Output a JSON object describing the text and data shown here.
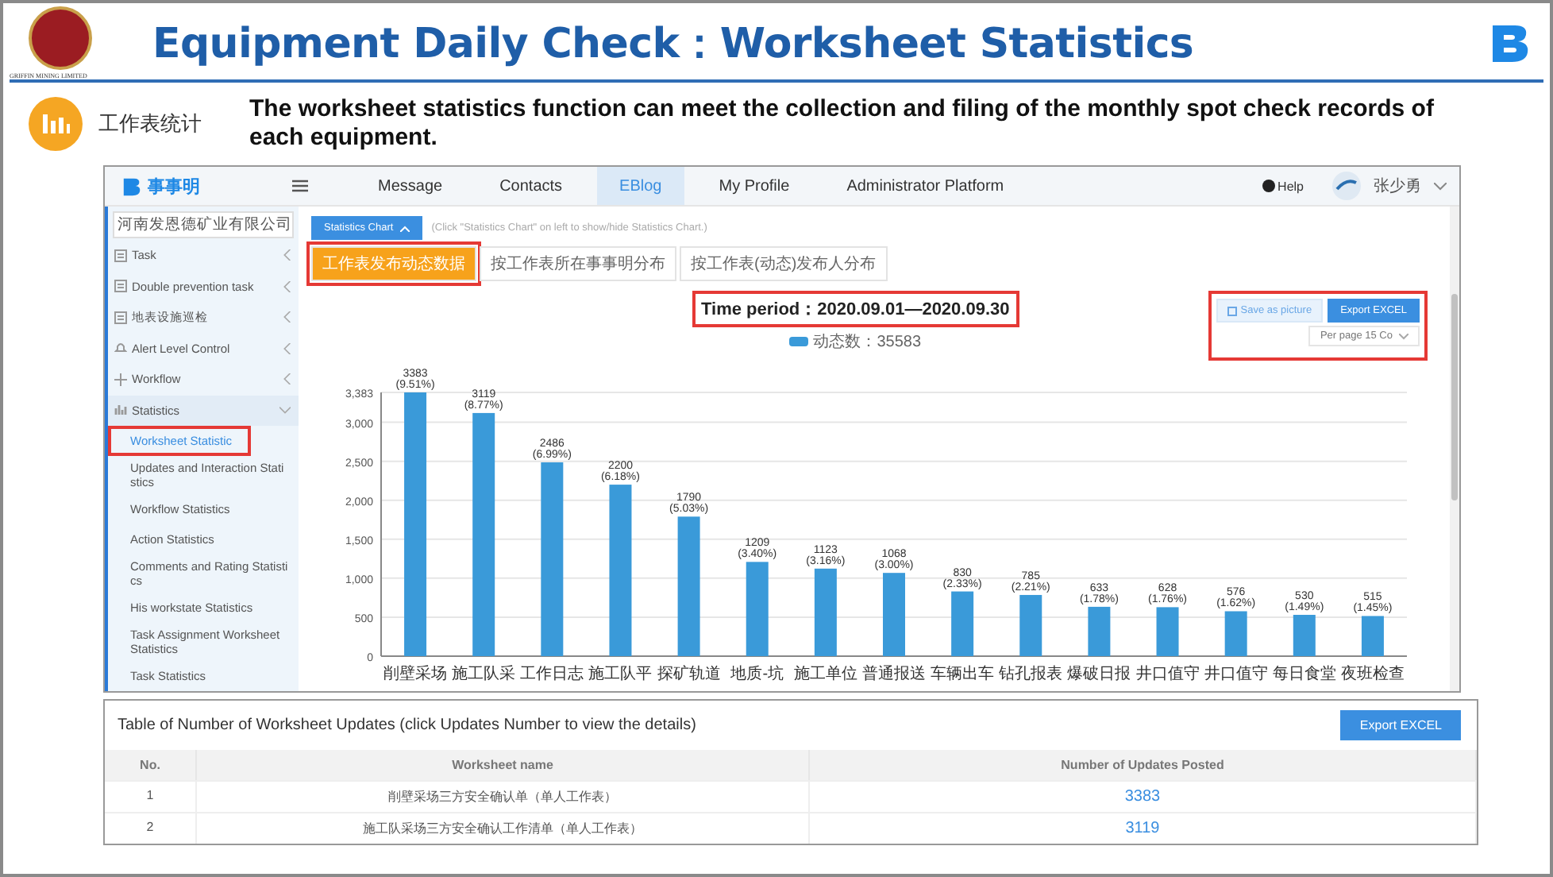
{
  "header": {
    "logo_caption": "GRIFFIN MINING LIMITED",
    "title": "Equipment Daily Check：Worksheet Statistics"
  },
  "intro": {
    "label": "工作表统计",
    "text": "The worksheet statistics function can meet the collection and filing of the monthly spot check records of each equipment."
  },
  "app": {
    "brand": "事事明",
    "nav": [
      {
        "label": "Message",
        "selected": false
      },
      {
        "label": "Contacts",
        "selected": false
      },
      {
        "label": "EBlog",
        "selected": true
      },
      {
        "label": "My Profile",
        "selected": false
      },
      {
        "label": "Administrator Platform",
        "selected": false
      }
    ],
    "help": "Help",
    "user": "张少勇",
    "company_select": "河南发恩德矿业有限公司",
    "sidebar": [
      {
        "label": "Task",
        "kind": "doc",
        "expanded": false
      },
      {
        "label": "Double prevention task",
        "kind": "doc",
        "expanded": false
      },
      {
        "label": "地表设施巡检",
        "kind": "doc",
        "expanded": false
      },
      {
        "label": "Alert Level Control",
        "kind": "bell",
        "expanded": false
      },
      {
        "label": "Workflow",
        "kind": "plus",
        "expanded": false
      },
      {
        "label": "Statistics",
        "kind": "chart",
        "expanded": true,
        "children": [
          {
            "label": "Worksheet Statistic",
            "selected": true
          },
          {
            "label": "Updates and Interaction Statistics",
            "selected": false
          },
          {
            "label": "Workflow Statistics",
            "selected": false
          },
          {
            "label": "Action Statistics",
            "selected": false
          },
          {
            "label": "Comments and Rating Statistics",
            "selected": false
          },
          {
            "label": "His workstate Statistics",
            "selected": false
          },
          {
            "label": "Task Assignment Worksheet Statistics",
            "selected": false
          },
          {
            "label": "Task Statistics",
            "selected": false
          }
        ]
      }
    ],
    "toggle_button": "Statistics Chart",
    "toggle_hint": "(Click \"Statistics Chart\" on left to show/hide Statistics Chart.)",
    "tabs": [
      {
        "label": "工作表发布动态数据",
        "selected": true
      },
      {
        "label": "按工作表所在事事明分布",
        "selected": false
      },
      {
        "label": "按工作表(动态)发布人分布",
        "selected": false
      }
    ],
    "save_button": "Save as picture",
    "export_button": "Export EXCEL",
    "per_page": "Per page 15 Co",
    "chart_data": {
      "type": "bar",
      "title": "Time period：2020.09.01—2020.09.30",
      "categories": [
        "削壁采场",
        "施工队采",
        "工作日志",
        "施工队平",
        "探矿轨道",
        "地质-坑",
        "施工单位",
        "普通报送",
        "车辆出车",
        "钻孔报表",
        "爆破日报",
        "井口值守",
        "井口值守",
        "每日食堂",
        "夜班检查"
      ],
      "series": [
        {
          "name": "动态数：35583",
          "color": "#3a9ad9",
          "values": [
            3383,
            3119,
            2486,
            2200,
            1790,
            1209,
            1123,
            1068,
            830,
            785,
            633,
            628,
            576,
            530,
            515
          ]
        }
      ],
      "ylim": [
        0,
        3383
      ],
      "grid": true,
      "yticks": [
        {
          "value": 0,
          "label": "0"
        },
        {
          "value": 500,
          "label": "500"
        },
        {
          "value": 1000,
          "label": "1,000"
        },
        {
          "value": 1500,
          "label": "1,500"
        },
        {
          "value": 2000,
          "label": "2,000"
        },
        {
          "value": 2500,
          "label": "2,500"
        },
        {
          "value": 3000,
          "label": "3,000"
        },
        {
          "value": 3383,
          "label": "3,383"
        }
      ],
      "value_labels": [
        "3383 (9.51%)",
        "3119 (8.77%)",
        "2486 (6.99%)",
        "2200 (6.18%)",
        "1790 (5.03%)",
        "1209 (3.40%)",
        "1123 (3.16%)",
        "1068 (3.00%)",
        "830 (2.33%)",
        "785 (2.21%)",
        "633 (1.78%)",
        "628 (1.76%)",
        "576 (1.62%)",
        "530 (1.49%)",
        "515 (1.45%)"
      ]
    }
  },
  "table": {
    "title": "Table of Number of Worksheet Updates (click Updates Number to view the details)",
    "export_button": "Export EXCEL",
    "columns": [
      "No.",
      "Worksheet name",
      "Number of Updates Posted"
    ],
    "rows": [
      {
        "no": "1",
        "name": "削壁采场三方安全确认单（单人工作表）",
        "count": "3383"
      },
      {
        "no": "2",
        "name": "施工队采场三方安全确认工作清单（单人工作表）",
        "count": "3119"
      }
    ]
  }
}
